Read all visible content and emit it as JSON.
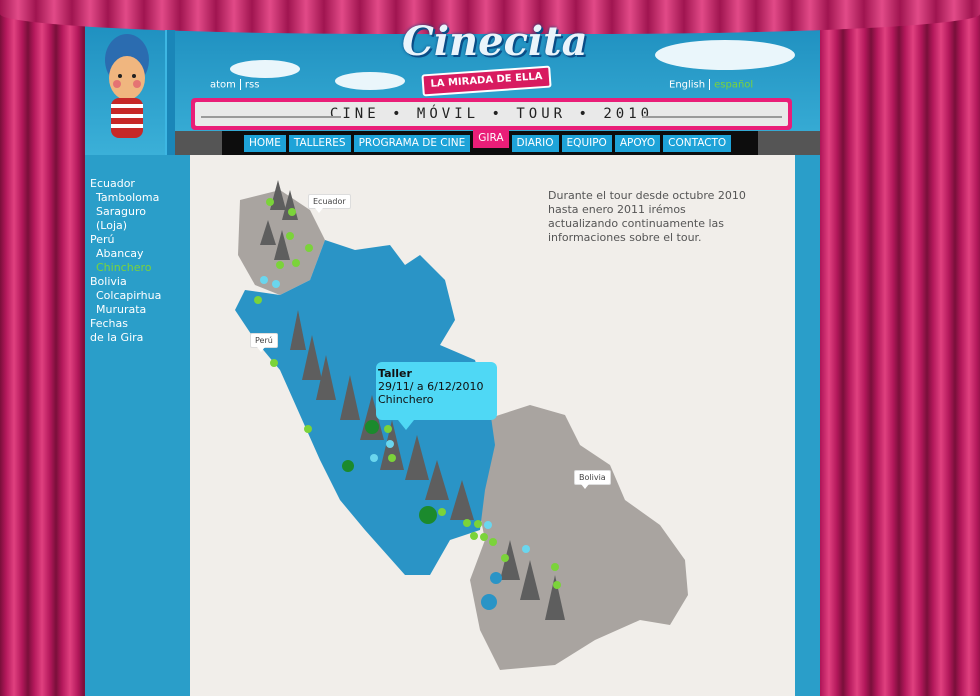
{
  "header": {
    "logo_title": "Cinecita",
    "logo_subtitle": "LA MIRADA DE ELLA",
    "banner": "CINE • MÓVIL • TOUR • 2010",
    "feed_links": [
      "atom",
      "rss"
    ],
    "languages": [
      {
        "label": "English",
        "active": false
      },
      {
        "label": "español",
        "active": true
      }
    ]
  },
  "nav": [
    {
      "label": "HOME",
      "active": false
    },
    {
      "label": "TALLERES",
      "active": false
    },
    {
      "label": "PROGRAMA DE CINE",
      "active": false
    },
    {
      "label": "GIRA",
      "active": true
    },
    {
      "label": "DIARIO",
      "active": false
    },
    {
      "label": "EQUIPO",
      "active": false
    },
    {
      "label": "APOYO",
      "active": false
    },
    {
      "label": "CONTACTO",
      "active": false
    }
  ],
  "sidebar": [
    {
      "label": "Ecuador",
      "sub": false,
      "active": false
    },
    {
      "label": "Tamboloma",
      "sub": true,
      "active": false
    },
    {
      "label": "Saraguro",
      "sub": true,
      "active": false
    },
    {
      "label": "(Loja)",
      "sub": true,
      "active": false
    },
    {
      "label": "Perú",
      "sub": false,
      "active": false
    },
    {
      "label": "Abancay",
      "sub": true,
      "active": false
    },
    {
      "label": "Chinchero",
      "sub": true,
      "active": true
    },
    {
      "label": "Bolivia",
      "sub": false,
      "active": false
    },
    {
      "label": "Colcapirhua",
      "sub": true,
      "active": false
    },
    {
      "label": "Mururata",
      "sub": true,
      "active": false
    },
    {
      "label": "Fechas",
      "sub": false,
      "active": false
    },
    {
      "label": "de la Gira",
      "sub": false,
      "active": false
    }
  ],
  "info_text": "Durante el tour desde octubre 2010 hasta enero 2011 irémos actualizando continuamente las informaciones sobre el tour.",
  "map": {
    "labels": [
      "Ecuador",
      "Perú",
      "Bolivia"
    ],
    "popup": {
      "title": "Taller",
      "dates": "29/11/ a 6/12/2010",
      "place": "Chinchero"
    }
  },
  "colors": {
    "accent_pink": "#e91e78",
    "nav_blue": "#1ea3d8",
    "active_green": "#7bd33a",
    "popup_cyan": "#4fd8f5"
  }
}
